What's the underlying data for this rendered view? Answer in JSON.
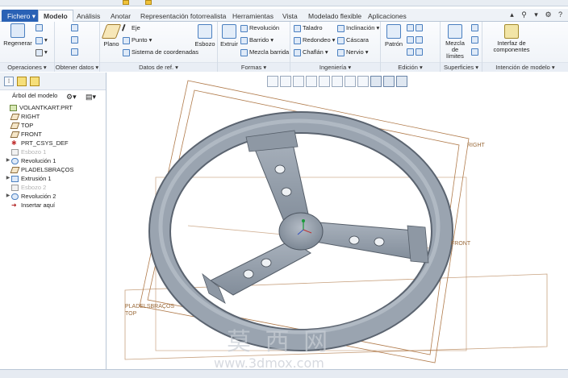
{
  "ribbon_tabs": [
    "Fichero",
    "Modelo",
    "Análisis",
    "Anotar",
    "Representación fotorrealista",
    "Herramientas",
    "Vista",
    "Modelado flexible",
    "Aplicaciones"
  ],
  "active_tab": "Modelo",
  "groups": {
    "operaciones": {
      "label": "Operaciones",
      "regenerar": "Regenerar"
    },
    "obtener_datos": {
      "label": "Obtener datos"
    },
    "datos_ref": {
      "label": "Datos de ref.",
      "plano": "Plano",
      "eje": "Eje",
      "punto": "Punto",
      "sistema": "Sistema de coordenadas",
      "esbozo": "Esbozo"
    },
    "formas": {
      "label": "Formas",
      "extruir": "Extruir",
      "revolucion": "Revolución",
      "barrido": "Barrido",
      "mezcla_barrida": "Mezcla barrida"
    },
    "ingenieria": {
      "label": "Ingeniería",
      "taladro": "Taladro",
      "redondeo": "Redondeo",
      "chaflan": "Chaflán",
      "inclinacion": "Inclinación",
      "cascara": "Cáscara",
      "nervio": "Nervio"
    },
    "edicion": {
      "label": "Edición",
      "patron": "Patrón"
    },
    "superficies": {
      "label": "Superficies",
      "mezcla_lineas": "Mezcla de límites"
    },
    "intencion": {
      "label": "Intención de modelo",
      "interfaz": "Interfaz de componentes"
    }
  },
  "model_tree": {
    "title": "Árbol del modelo",
    "items": [
      {
        "label": "VOLANTKART.PRT",
        "type": "part",
        "expandable": false,
        "dim": false
      },
      {
        "label": "RIGHT",
        "type": "plane",
        "expandable": false,
        "dim": false
      },
      {
        "label": "TOP",
        "type": "plane",
        "expandable": false,
        "dim": false
      },
      {
        "label": "FRONT",
        "type": "plane",
        "expandable": false,
        "dim": false
      },
      {
        "label": "PRT_CSYS_DEF",
        "type": "csys",
        "expandable": false,
        "dim": false
      },
      {
        "label": "Esbozo 1",
        "type": "sketch",
        "expandable": false,
        "dim": true
      },
      {
        "label": "Revolución 1",
        "type": "revolve",
        "expandable": true,
        "dim": false
      },
      {
        "label": "PLADELSBRAÇOS",
        "type": "plane",
        "expandable": false,
        "dim": false
      },
      {
        "label": "Extrusión 1",
        "type": "extrude",
        "expandable": true,
        "dim": false
      },
      {
        "label": "Esbozo 2",
        "type": "sketch",
        "expandable": false,
        "dim": true
      },
      {
        "label": "Revolución 2",
        "type": "revolve",
        "expandable": true,
        "dim": false
      },
      {
        "label": "Insertar aquí",
        "type": "insert",
        "expandable": false,
        "dim": false
      }
    ]
  },
  "datum_labels": {
    "right": "RIGHT",
    "front": "FRONT",
    "pladels": "PLADELSBRAÇOS",
    "top": "TOP"
  },
  "watermark": {
    "cn": "莫 西 网",
    "url": "www.3dmox.com"
  },
  "colors": {
    "accent": "#2a62b5",
    "datum": "#b07a4a",
    "wheel": "#8e98a4"
  }
}
